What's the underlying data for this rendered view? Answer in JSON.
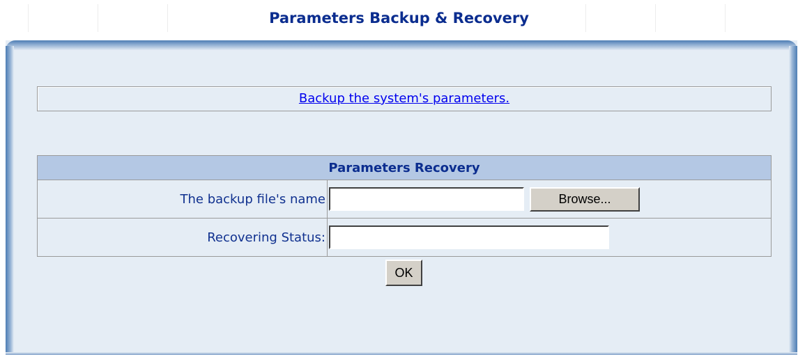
{
  "page": {
    "title": "Parameters Backup & Recovery"
  },
  "backup": {
    "link_text": "Backup the system's parameters."
  },
  "recovery": {
    "section_title": "Parameters Recovery",
    "file_label": "The backup file's name",
    "file_value": "",
    "browse_label": "Browse...",
    "status_label": "Recovering Status:",
    "status_value": "",
    "ok_label": "OK"
  }
}
